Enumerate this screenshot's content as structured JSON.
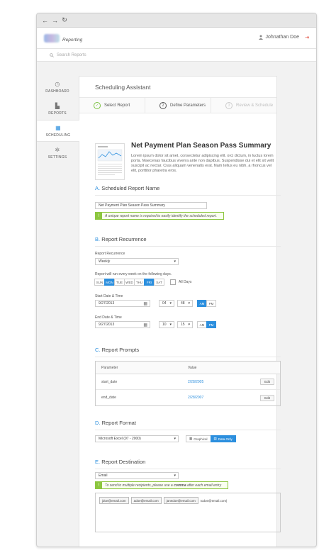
{
  "browser": {
    "back": "←",
    "forward": "→",
    "reload": "↻"
  },
  "header": {
    "app_name": "Reporting",
    "user_name": "Johnathan Doe",
    "logout_icon": "logout-icon"
  },
  "search": {
    "placeholder": "Search Reports"
  },
  "sidebar": {
    "items": [
      {
        "label": "DASHBOARD",
        "icon": "dashboard-icon",
        "active": false
      },
      {
        "label": "REPORTS",
        "icon": "bar-chart-icon",
        "active": false
      },
      {
        "label": "SCHEDULING",
        "icon": "calendar-icon",
        "active": true
      },
      {
        "label": "SETTINGS",
        "icon": "gear-icon",
        "active": false
      }
    ]
  },
  "page": {
    "title": "Scheduling Assistant"
  },
  "steps": [
    {
      "num": "✓",
      "label": "Select Report",
      "state": "done"
    },
    {
      "num": "2",
      "label": "Define Parameters",
      "state": "current"
    },
    {
      "num": "3",
      "label": "Review & Schedule",
      "state": "pending"
    }
  ],
  "report": {
    "title": "Net Payment Plan Season Pass Summary",
    "description": "Lorem ipsum dolor sit amet, consectetur adipiscing elit. orci dictum, in luctus lorem porta. Maecenas faucibus viverra ante non dapibus. Suspendisse dui et elit sit velit suscipit ac nectar. Cras aliquam venenatis erat. Nam tellus eu nibh, a rhoncus vel elit, porttitor pharetra eros."
  },
  "section_a": {
    "letter": "A.",
    "title": "Scheduled Report Name",
    "name_value": "Net Payment Plan Season Pass Summary",
    "hint": "A unique report name is required to easily identify the scheduled report."
  },
  "section_b": {
    "letter": "B.",
    "title": "Report Recurrence",
    "recurrence_label": "Report Recurrence",
    "recurrence_value": "Weekly",
    "days_label": "Report will run every week on the following days.",
    "days": [
      {
        "label": "SUN",
        "on": false
      },
      {
        "label": "MON",
        "on": true
      },
      {
        "label": "TUE",
        "on": false
      },
      {
        "label": "WED",
        "on": false
      },
      {
        "label": "THU",
        "on": false
      },
      {
        "label": "FRI",
        "on": true
      },
      {
        "label": "SAT",
        "on": false
      }
    ],
    "all_days": "All Days",
    "start_label": "Start Date & Time",
    "start_date": "9/27/2013",
    "start_hour": "04",
    "start_min": "48",
    "end_label": "End Date & Time",
    "end_date": "9/27/2013",
    "end_hour": "10",
    "end_min": "15",
    "am": "AM",
    "pm": "PM"
  },
  "section_c": {
    "letter": "C.",
    "title": "Report Prompts",
    "col_param": "Parameter",
    "col_value": "Value",
    "rows": [
      {
        "param": "start_date",
        "value": "2/28/2005",
        "action": "Edit"
      },
      {
        "param": "end_date",
        "value": "2/28/2007",
        "action": "Edit"
      }
    ]
  },
  "section_d": {
    "letter": "D.",
    "title": "Report Format",
    "format_value": "Microsoft Excel (97 - 2000)",
    "graphical": "Graphical",
    "data_only": "Data Only"
  },
  "section_e": {
    "letter": "E.",
    "title": "Report Destination",
    "dest_value": "Email",
    "hint_pre": "To send to multiple recipients, please use a ",
    "hint_bold": "comma",
    "hint_post": " after each email entry",
    "emails": [
      "jdoe@email.com",
      "adoe@email.com",
      "janedoe@email.com"
    ],
    "typing": "todoe@email.com|"
  },
  "colors": {
    "accent": "#2c8fde",
    "success": "#8cc63f",
    "danger": "#e24b3b"
  }
}
